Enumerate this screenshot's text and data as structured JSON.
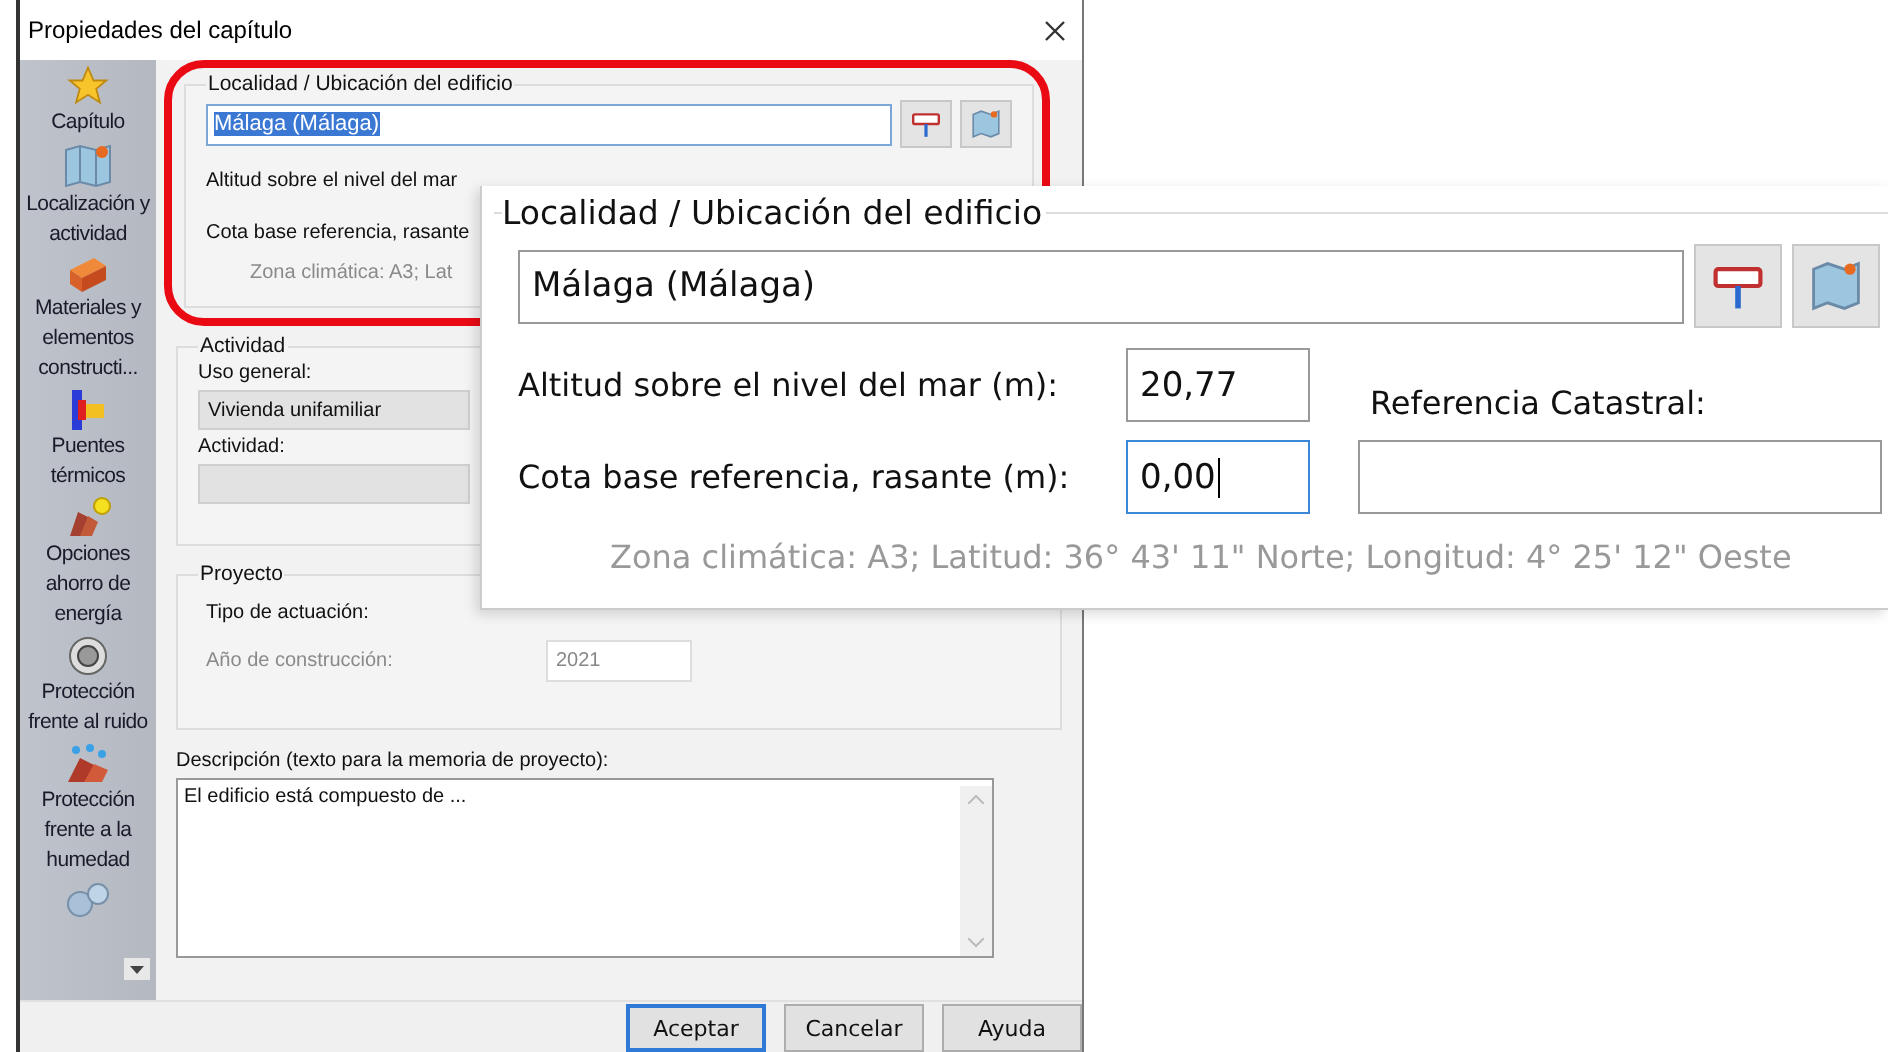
{
  "window": {
    "title": "Propiedades del capítulo"
  },
  "sidebar": {
    "items": [
      {
        "label": "Capítulo",
        "kind": "star"
      },
      {
        "label": "Localización y actividad",
        "kind": "map"
      },
      {
        "label": "Materiales y elementos constructi...",
        "kind": "brick"
      },
      {
        "label": "Puentes térmicos",
        "kind": "thermal"
      },
      {
        "label": "Opciones ahorro de energía",
        "kind": "energy"
      },
      {
        "label": "Protección frente al ruido",
        "kind": "sound"
      },
      {
        "label": "Protección frente a la humedad",
        "kind": "moisture"
      },
      {
        "kind": "gear"
      }
    ]
  },
  "location": {
    "legend": "Localidad / Ubicación del edificio",
    "value": "Málaga (Málaga)",
    "value_selected": true,
    "altitude_label": "Altitud sobre el nivel del mar",
    "base_label": "Cota base referencia, rasante",
    "climate": "Zona climática: A3; Lat"
  },
  "activity": {
    "legend": "Actividad",
    "use_label": "Uso general:",
    "use_value": "Vivienda unifamiliar",
    "activity_label": "Actividad:"
  },
  "project": {
    "legend": "Proyecto",
    "type_label": "Tipo de actuación:",
    "year_label": "Año de construcción:",
    "year_value": "2021",
    "year_disabled": true
  },
  "description": {
    "label": "Descripción (texto para la memoria de proyecto):",
    "value": "El edificio está compuesto de ..."
  },
  "buttons": [
    {
      "label": "Aceptar",
      "default": true
    },
    {
      "label": "Cancelar",
      "default": false
    },
    {
      "label": "Ayuda",
      "default": false
    }
  ],
  "zoom_inset": {
    "legend": "Localidad / Ubicación del edificio",
    "location_value": "Málaga (Málaga)",
    "altitude_label": "Altitud sobre el nivel del mar (m):",
    "altitude_value": "20,77",
    "cadastral_label": "Referencia Catastral:",
    "base_label": "Cota base referencia, rasante (m):",
    "base_value": "0,00",
    "base_focused": true,
    "climate": "Zona climática: A3; Latitud: 36° 43' 11\" Norte; Longitud: 4° 25' 12\" Oeste"
  }
}
